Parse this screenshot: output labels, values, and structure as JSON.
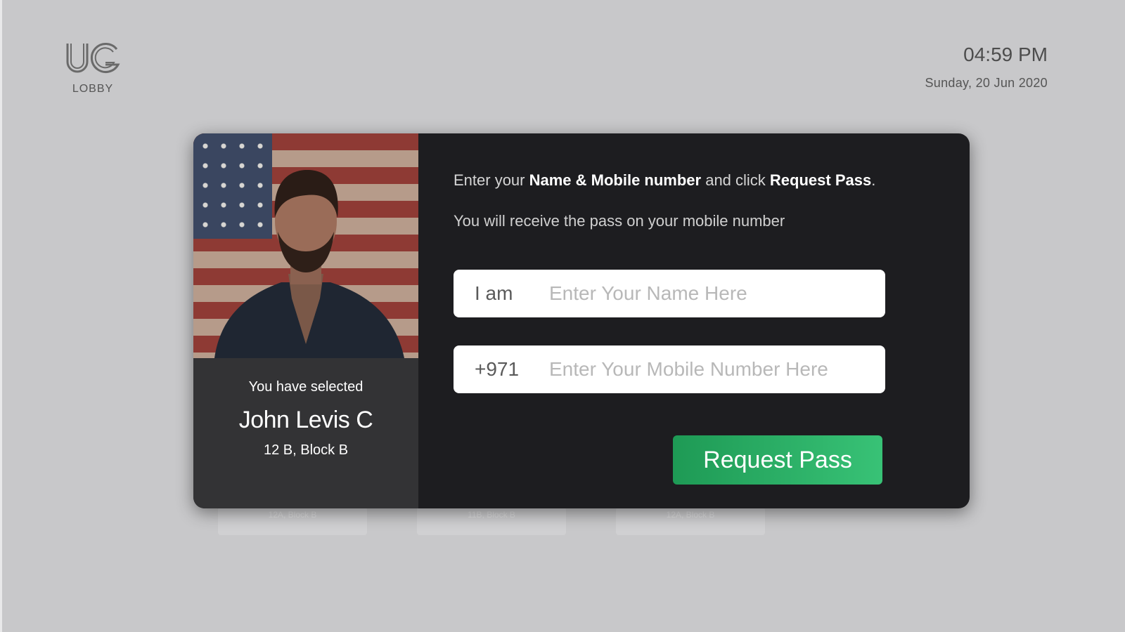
{
  "header": {
    "logo_text": "UG",
    "brand_label": "LOBBY",
    "time": "04:59 PM",
    "date": "Sunday, 20 Jun 2020"
  },
  "background_cards": [
    {
      "label": "12A, Block B"
    },
    {
      "label": "11B, Block B"
    },
    {
      "label": "12A, Block B"
    }
  ],
  "selection": {
    "label": "You have selected",
    "name": "John Levis C",
    "unit": "12 B, Block B"
  },
  "form": {
    "instruction": {
      "pre": "Enter your ",
      "bold1": "Name & Mobile number",
      "mid": " and click ",
      "bold2": "Request Pass",
      "post": "."
    },
    "note": "You will receive the pass on your mobile number",
    "name_prefix": "I am",
    "name_placeholder": "Enter Your Name Here",
    "mobile_prefix": "+971",
    "mobile_placeholder": "Enter Your Mobile Number Here",
    "submit_label": "Request Pass"
  },
  "colors": {
    "background": "#c8c8ca",
    "modal": "#1d1d20",
    "profile_pane": "#333335",
    "button_start": "#1e9a55",
    "button_end": "#38c276"
  }
}
